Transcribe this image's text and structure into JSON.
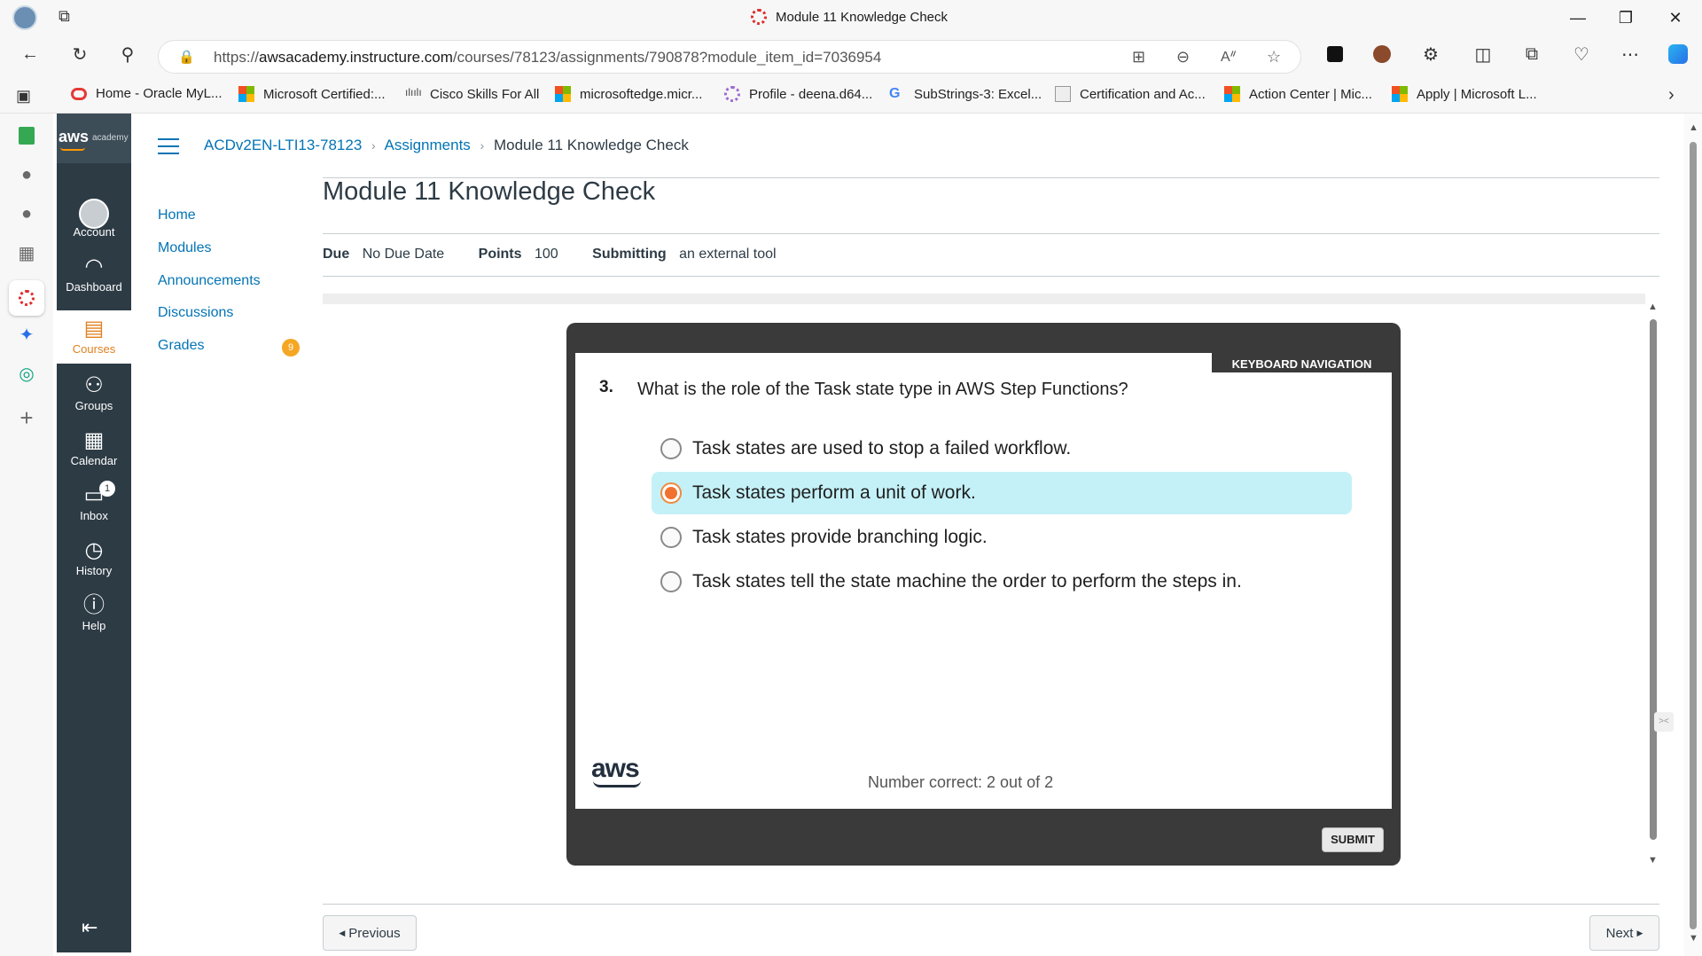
{
  "browser": {
    "tab_title": "Module 11 Knowledge Check",
    "url_prefix": "https://",
    "url_host": "awsacademy.instructure.com",
    "url_path": "/courses/78123/assignments/790878?module_item_id=7036954"
  },
  "favorites": [
    {
      "label": "Home - Oracle MyL...",
      "icon": "oracle-icon"
    },
    {
      "label": "Microsoft Certified:...",
      "icon": "microsoft-icon"
    },
    {
      "label": "Cisco Skills For All",
      "icon": "cisco-icon"
    },
    {
      "label": "microsoftedge.micr...",
      "icon": "microsoft-icon"
    },
    {
      "label": "Profile - deena.d64...",
      "icon": "profile-icon"
    },
    {
      "label": "SubStrings-3: Excel...",
      "icon": "google-icon"
    },
    {
      "label": "Certification and Ac...",
      "icon": "certification-icon"
    },
    {
      "label": "Action Center | Mic...",
      "icon": "microsoft-icon"
    },
    {
      "label": "Apply | Microsoft L...",
      "icon": "microsoft-icon"
    }
  ],
  "global_nav": {
    "logo_text": "aws",
    "logo_sub": "academy",
    "items": [
      {
        "label": "Account",
        "icon": "account-icon"
      },
      {
        "label": "Dashboard",
        "icon": "dashboard-icon"
      },
      {
        "label": "Courses",
        "icon": "courses-icon"
      },
      {
        "label": "Groups",
        "icon": "groups-icon"
      },
      {
        "label": "Calendar",
        "icon": "calendar-icon"
      },
      {
        "label": "Inbox",
        "icon": "inbox-icon",
        "badge": "1"
      },
      {
        "label": "History",
        "icon": "history-icon"
      },
      {
        "label": "Help",
        "icon": "help-icon"
      }
    ]
  },
  "breadcrumb": {
    "course": "ACDv2EN-LTI13-78123",
    "section": "Assignments",
    "current": "Module 11 Knowledge Check"
  },
  "course_nav": {
    "items": [
      "Home",
      "Modules",
      "Announcements",
      "Discussions",
      "Grades"
    ],
    "grades_badge": "9"
  },
  "assignment": {
    "title": "Module 11 Knowledge Check",
    "due_label": "Due",
    "due_value": "No Due Date",
    "points_label": "Points",
    "points_value": "100",
    "submitting_label": "Submitting",
    "submitting_value": "an external tool"
  },
  "quiz": {
    "keyboard_nav": "KEYBOARD NAVIGATION",
    "question_number": "3.",
    "question": "What is the role of the Task state type in AWS Step Functions?",
    "options": [
      "Task states are used to stop a failed workflow.",
      "Task states perform a unit of work.",
      "Task states provide branching logic.",
      "Task states tell the state machine the order to perform the steps in."
    ],
    "selected_index": 1,
    "logo_text": "aws",
    "score_text": "Number correct: 2 out of 2",
    "submit_label": "SUBMIT"
  },
  "footer": {
    "previous_label": "Previous",
    "next_label": "Next"
  }
}
